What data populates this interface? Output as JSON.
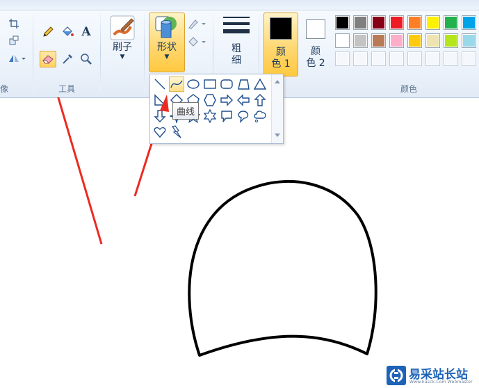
{
  "ribbon": {
    "image_group_label": "像",
    "tools_group_label": "工具",
    "colors_group_label": "颜色",
    "brushes_label": "刷子",
    "shapes_label": "形状",
    "size_label_1": "粗",
    "size_label_2": "细",
    "color1_label_1": "颜",
    "color1_label_2": "色 1",
    "color2_label_1": "颜",
    "color2_label_2": "色 2",
    "text_tool_glyph": "A",
    "color1": "#000000",
    "color2": "#ffffff"
  },
  "palette": [
    "#000000",
    "#7f7f7f",
    "#880015",
    "#ed1c24",
    "#ff7f27",
    "#fff200",
    "#22b14c",
    "#00a2e8",
    "#ffffff",
    "#c3c3c3",
    "#b97a57",
    "#ffaec9",
    "#ffc90e",
    "#efe4b0",
    "#b5e61d",
    "#99d9ea"
  ],
  "shapes_popup": {
    "shapes": [
      "line",
      "curve",
      "oval",
      "rectangle",
      "rounded-rectangle",
      "polygon",
      "triangle",
      "right-triangle",
      "diamond",
      "pentagon",
      "hexagon",
      "right-arrow",
      "left-arrow",
      "up-arrow",
      "down-arrow",
      "four-point-star",
      "five-point-star",
      "six-point-star",
      "rounded-callout",
      "oval-callout",
      "cloud-callout",
      "heart",
      "lightning"
    ],
    "hovered": "curve",
    "tooltip": "曲线"
  },
  "watermark": {
    "text": "易采站长站",
    "subtext": "Www.Easck.Com Webmaster"
  },
  "colors": {
    "annotation_arrow": "#ec2a22",
    "accent_active": "#ffd25e",
    "shape_stroke": "#1e4e8c"
  }
}
